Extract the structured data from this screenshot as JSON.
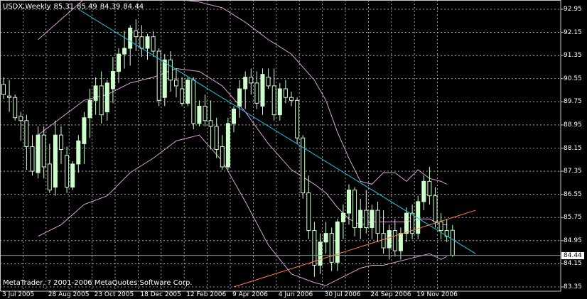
{
  "header": {
    "symbol": "USDX,Weekly",
    "open": "85.31",
    "high": "85.49",
    "low": "84.39",
    "close": "84.44"
  },
  "copyright": "MetaTrader, ? 2001-2006 MetaQuotes Software Corp.",
  "current_price_label": "84.44",
  "colors": {
    "background": "#000000",
    "grid": "#c8c8c8",
    "bull_candle": "#ccffcc",
    "bear_candle": "#000000",
    "wick": "#ccffcc",
    "bollinger": "#dda0dd",
    "resistance_line": "#1ec8e6",
    "support_line": "#ff7d41",
    "price_line": "#5f9ea0",
    "text": "#ffffff"
  },
  "chart_data": {
    "type": "candlestick",
    "title": "USDX,Weekly",
    "y_ticks": [
      "92.95",
      "92.15",
      "91.35",
      "90.55",
      "89.75",
      "88.95",
      "88.15",
      "87.35",
      "86.55",
      "85.75",
      "84.95",
      "84.15",
      "83.35"
    ],
    "x_ticks": [
      {
        "label": "3 Jul 2005",
        "index": 0
      },
      {
        "label": "28 Aug 2005",
        "index": 8
      },
      {
        "label": "23 Oct 2005",
        "index": 16
      },
      {
        "label": "18 Dec 2005",
        "index": 24
      },
      {
        "label": "12 Feb 2006",
        "index": 32
      },
      {
        "label": "9 Apr 2006",
        "index": 40
      },
      {
        "label": "4 Jun 2006",
        "index": 48
      },
      {
        "label": "30 Jul 2006",
        "index": 56
      },
      {
        "label": "24 Sep 2006",
        "index": 64
      },
      {
        "label": "19 Nov 2006",
        "index": 72
      }
    ],
    "ylim": [
      83.35,
      93.0
    ],
    "grid": true,
    "current_price": 84.44,
    "candles": [
      [
        90.35,
        90.6,
        89.85,
        90.0
      ],
      [
        89.95,
        90.5,
        89.4,
        89.9
      ],
      [
        89.9,
        90.0,
        89.1,
        89.2
      ],
      [
        89.25,
        89.4,
        88.4,
        89.1
      ],
      [
        89.1,
        89.3,
        87.4,
        88.2
      ],
      [
        88.2,
        88.6,
        87.2,
        87.35
      ],
      [
        87.3,
        88.9,
        87.1,
        88.6
      ],
      [
        88.6,
        88.9,
        87.1,
        87.5
      ],
      [
        87.6,
        88.3,
        86.6,
        86.7
      ],
      [
        86.8,
        89.1,
        86.5,
        88.6
      ],
      [
        88.6,
        88.9,
        87.6,
        88.1
      ],
      [
        87.9,
        88.2,
        86.6,
        86.8
      ],
      [
        86.8,
        87.7,
        86.7,
        87.6
      ],
      [
        87.6,
        88.6,
        87.3,
        88.4
      ],
      [
        88.3,
        89.4,
        87.6,
        89.2
      ],
      [
        89.2,
        90.2,
        88.5,
        89.8
      ],
      [
        89.8,
        90.6,
        89.3,
        90.3
      ],
      [
        90.3,
        90.8,
        89.0,
        89.3
      ],
      [
        89.4,
        90.5,
        89.1,
        90.4
      ],
      [
        90.2,
        91.3,
        89.7,
        90.8
      ],
      [
        90.8,
        91.6,
        90.4,
        91.4
      ],
      [
        91.4,
        92.2,
        90.9,
        91.6
      ],
      [
        91.6,
        92.4,
        91.0,
        92.3
      ],
      [
        92.2,
        92.6,
        91.5,
        92.0
      ],
      [
        92.0,
        92.4,
        91.3,
        91.6
      ],
      [
        91.6,
        92.1,
        91.2,
        92.0
      ],
      [
        92.0,
        92.2,
        91.3,
        91.5
      ],
      [
        91.5,
        91.6,
        89.6,
        89.8
      ],
      [
        89.9,
        91.4,
        89.6,
        91.2
      ],
      [
        91.2,
        91.5,
        90.1,
        90.5
      ],
      [
        90.5,
        90.9,
        89.9,
        90.3
      ],
      [
        90.2,
        90.6,
        89.6,
        89.7
      ],
      [
        89.7,
        90.6,
        89.6,
        90.5
      ],
      [
        90.5,
        90.6,
        88.8,
        89.0
      ],
      [
        89.0,
        89.8,
        88.9,
        89.6
      ],
      [
        89.6,
        90.0,
        88.9,
        89.1
      ],
      [
        89.1,
        89.8,
        88.1,
        88.9
      ],
      [
        88.9,
        89.2,
        87.8,
        88.1
      ],
      [
        88.2,
        88.6,
        87.4,
        87.5
      ],
      [
        87.5,
        89.2,
        87.4,
        89.0
      ],
      [
        89.0,
        89.6,
        88.7,
        89.5
      ],
      [
        89.6,
        90.5,
        89.2,
        90.2
      ],
      [
        90.2,
        90.8,
        89.5,
        90.6
      ],
      [
        90.6,
        90.9,
        90.0,
        90.4
      ],
      [
        90.4,
        90.8,
        89.5,
        89.7
      ],
      [
        89.6,
        90.9,
        89.3,
        90.7
      ],
      [
        90.6,
        90.9,
        90.2,
        90.3
      ],
      [
        90.3,
        90.9,
        89.1,
        89.3
      ],
      [
        89.3,
        90.4,
        89.1,
        90.2
      ],
      [
        90.2,
        90.5,
        89.7,
        89.9
      ],
      [
        89.9,
        90.1,
        89.6,
        89.8
      ],
      [
        89.8,
        89.9,
        88.3,
        88.5
      ],
      [
        88.5,
        88.6,
        86.4,
        86.6
      ],
      [
        86.6,
        87.2,
        85.0,
        85.3
      ],
      [
        85.3,
        85.6,
        83.7,
        84.1
      ],
      [
        84.1,
        85.2,
        83.8,
        84.9
      ],
      [
        84.9,
        85.6,
        84.5,
        85.2
      ],
      [
        85.2,
        85.4,
        83.9,
        84.2
      ],
      [
        84.2,
        85.7,
        83.9,
        85.6
      ],
      [
        85.6,
        86.2,
        85.0,
        85.9
      ],
      [
        85.9,
        86.9,
        85.5,
        86.7
      ],
      [
        86.7,
        86.8,
        85.1,
        85.4
      ],
      [
        85.4,
        86.4,
        85.0,
        86.0
      ],
      [
        86.0,
        86.7,
        85.2,
        85.4
      ],
      [
        85.4,
        86.2,
        85.0,
        86.0
      ],
      [
        86.0,
        86.3,
        84.9,
        85.2
      ],
      [
        85.2,
        86.0,
        84.5,
        84.7
      ],
      [
        84.7,
        85.5,
        84.3,
        85.3
      ],
      [
        85.3,
        85.7,
        84.4,
        84.6
      ],
      [
        84.6,
        85.4,
        84.3,
        85.2
      ],
      [
        85.2,
        86.1,
        84.9,
        85.9
      ],
      [
        85.9,
        86.2,
        85.0,
        85.2
      ],
      [
        85.2,
        86.5,
        85.0,
        86.3
      ],
      [
        86.3,
        87.2,
        86.0,
        87.0
      ],
      [
        87.0,
        87.5,
        86.2,
        86.5
      ],
      [
        86.5,
        86.8,
        85.4,
        85.6
      ],
      [
        85.6,
        85.9,
        85.0,
        85.3
      ],
      [
        85.3,
        85.7,
        84.9,
        85.1
      ],
      [
        85.31,
        85.49,
        84.39,
        84.44
      ]
    ],
    "bollinger_upper": [
      [
        6,
        91.9
      ],
      [
        10,
        92.6
      ],
      [
        14,
        93.3
      ],
      [
        18,
        93.6
      ],
      [
        22,
        93.5
      ],
      [
        26,
        93.4
      ],
      [
        30,
        93.3
      ],
      [
        34,
        93.2
      ],
      [
        38,
        93.0
      ],
      [
        42,
        92.5
      ],
      [
        46,
        91.9
      ],
      [
        50,
        91.4
      ],
      [
        54,
        90.5
      ],
      [
        56,
        89.8
      ],
      [
        58,
        88.7
      ],
      [
        60,
        87.8
      ],
      [
        62,
        87.0
      ],
      [
        64,
        86.9
      ],
      [
        66,
        87.3
      ],
      [
        68,
        87.3
      ],
      [
        70,
        87.0
      ],
      [
        72,
        87.4
      ],
      [
        74,
        87.1
      ],
      [
        76,
        87.0
      ],
      [
        77,
        86.9
      ]
    ],
    "bollinger_middle": [
      [
        6,
        88.6
      ],
      [
        10,
        89.2
      ],
      [
        14,
        89.8
      ],
      [
        18,
        90.0
      ],
      [
        22,
        90.4
      ],
      [
        26,
        90.6
      ],
      [
        30,
        90.9
      ],
      [
        34,
        90.8
      ],
      [
        38,
        90.3
      ],
      [
        42,
        89.4
      ],
      [
        46,
        88.3
      ],
      [
        50,
        87.4
      ],
      [
        54,
        86.9
      ],
      [
        56,
        86.6
      ],
      [
        58,
        86.1
      ],
      [
        60,
        85.7
      ],
      [
        62,
        85.5
      ],
      [
        64,
        85.6
      ],
      [
        66,
        85.6
      ],
      [
        68,
        85.6
      ],
      [
        70,
        85.6
      ],
      [
        72,
        85.7
      ],
      [
        74,
        85.7
      ],
      [
        76,
        85.5
      ],
      [
        77,
        85.5
      ]
    ],
    "bollinger_lower": [
      [
        6,
        85.1
      ],
      [
        10,
        85.5
      ],
      [
        14,
        86.2
      ],
      [
        18,
        86.5
      ],
      [
        22,
        87.3
      ],
      [
        26,
        87.8
      ],
      [
        30,
        88.4
      ],
      [
        34,
        88.6
      ],
      [
        38,
        87.7
      ],
      [
        42,
        86.3
      ],
      [
        46,
        84.8
      ],
      [
        50,
        83.8
      ],
      [
        54,
        83.5
      ],
      [
        56,
        83.4
      ],
      [
        58,
        83.6
      ],
      [
        60,
        83.8
      ],
      [
        62,
        84.0
      ],
      [
        64,
        84.1
      ],
      [
        66,
        84.1
      ],
      [
        68,
        84.2
      ],
      [
        70,
        84.3
      ],
      [
        72,
        84.4
      ],
      [
        74,
        84.5
      ],
      [
        76,
        84.3
      ],
      [
        77,
        84.4
      ]
    ],
    "trendline_resistance": [
      [
        13,
        92.95
      ],
      [
        82,
        84.5
      ]
    ],
    "trendline_support": [
      [
        40,
        83.35
      ],
      [
        82,
        86.0
      ]
    ]
  }
}
